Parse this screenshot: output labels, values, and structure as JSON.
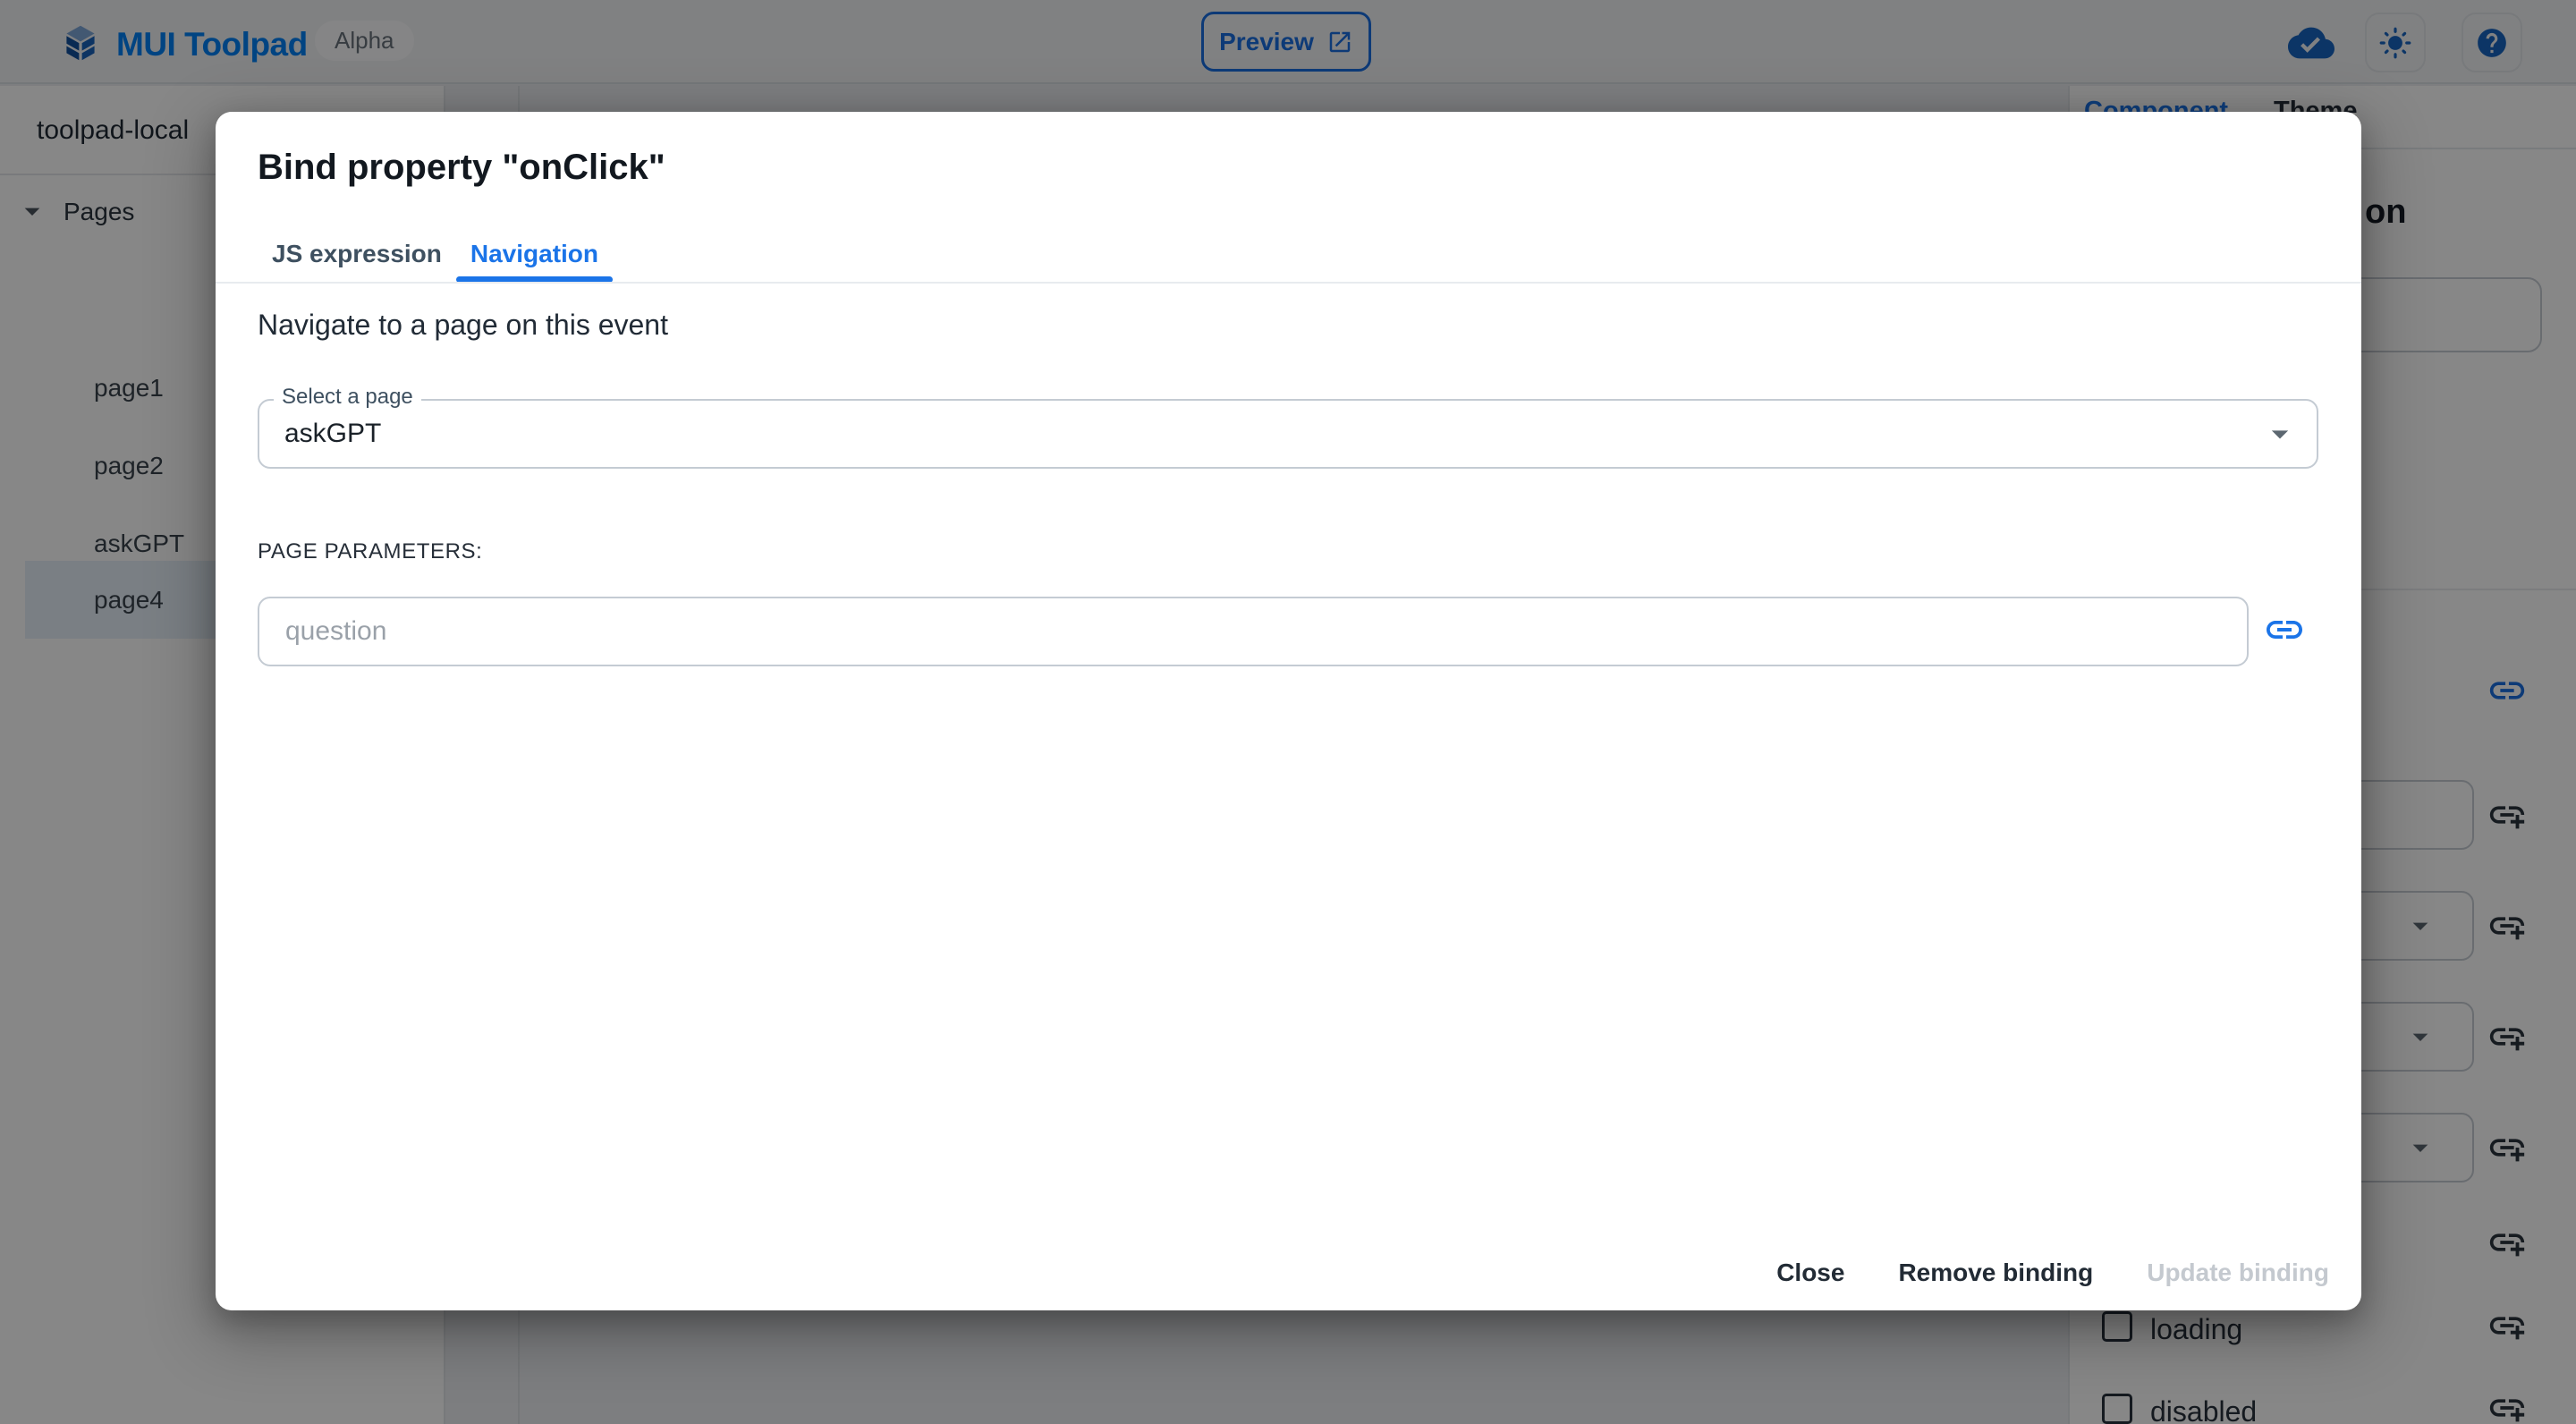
{
  "header": {
    "brand": "MUI Toolpad",
    "badge": "Alpha",
    "preview_label": "Preview",
    "icons": [
      "toolpad-logo-icon",
      "open-in-new-icon",
      "cloud-done-icon",
      "light-mode-icon",
      "help-icon"
    ]
  },
  "sidebar": {
    "project_name": "toolpad-local",
    "tree": {
      "section_label": "Pages",
      "items": [
        {
          "label": "page1",
          "selected": false
        },
        {
          "label": "page2",
          "selected": false
        },
        {
          "label": "askGPT",
          "selected": false
        },
        {
          "label": "page4",
          "selected": true
        }
      ]
    }
  },
  "right_panel": {
    "tabs": [
      {
        "label": "Component",
        "active": true
      },
      {
        "label": "Theme",
        "active": false
      }
    ],
    "heading_visible_fragment": "on",
    "checkbox_rows": [
      {
        "label": "loading",
        "checked": false
      },
      {
        "label": "disabled",
        "checked": false
      }
    ],
    "icons": [
      "link-icon",
      "add-link-icon",
      "chevron-down-icon"
    ]
  },
  "dialog": {
    "title": "Bind property \"onClick\"",
    "tabs": [
      {
        "label": "JS expression",
        "active": false
      },
      {
        "label": "Navigation",
        "active": true
      }
    ],
    "description": "Navigate to a page on this event",
    "page_select": {
      "label": "Select a page",
      "value": "askGPT"
    },
    "parameters_heading": "PAGE PARAMETERS:",
    "parameter_input": {
      "placeholder": "question",
      "value": ""
    },
    "actions": {
      "close": "Close",
      "remove": "Remove binding",
      "update": "Update binding"
    },
    "update_disabled": true
  },
  "colors": {
    "accent_blue": "#1B74E8",
    "brand_blue": "#0080F5",
    "header_icon_blue": "#1865C0",
    "backdrop": "rgba(0,0,0,0.47)",
    "field_border": "#C4CBD3",
    "disabled_text": "#C4C9CF",
    "selected_row_bg": "#E7F0FA"
  }
}
